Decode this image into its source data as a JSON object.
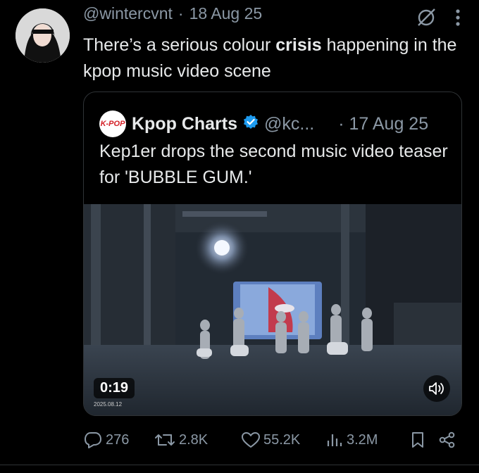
{
  "tweet": {
    "handle": "@wintercvnt",
    "dot": "·",
    "date": "18 Aug 25",
    "text_before": "There’s a serious colour ",
    "text_bold": "crisis",
    "text_after": " happening in the kpop music video scene"
  },
  "quote": {
    "logo_text": "K-POP",
    "name": "Kpop Charts",
    "handle": "@kc...",
    "date": "· 17 Aug 25",
    "text": "Kep1er drops the second music video teaser for 'BUBBLE GUM.'",
    "video": {
      "duration": "0:19",
      "timestamp": "2025.08.12"
    }
  },
  "actions": {
    "replies": "276",
    "reposts": "2.8K",
    "likes": "55.2K",
    "views": "3.2M"
  },
  "colors": {
    "background": "#000000",
    "text": "#e7e9ea",
    "muted": "#8b98a5",
    "verified": "#1d9bf0"
  }
}
